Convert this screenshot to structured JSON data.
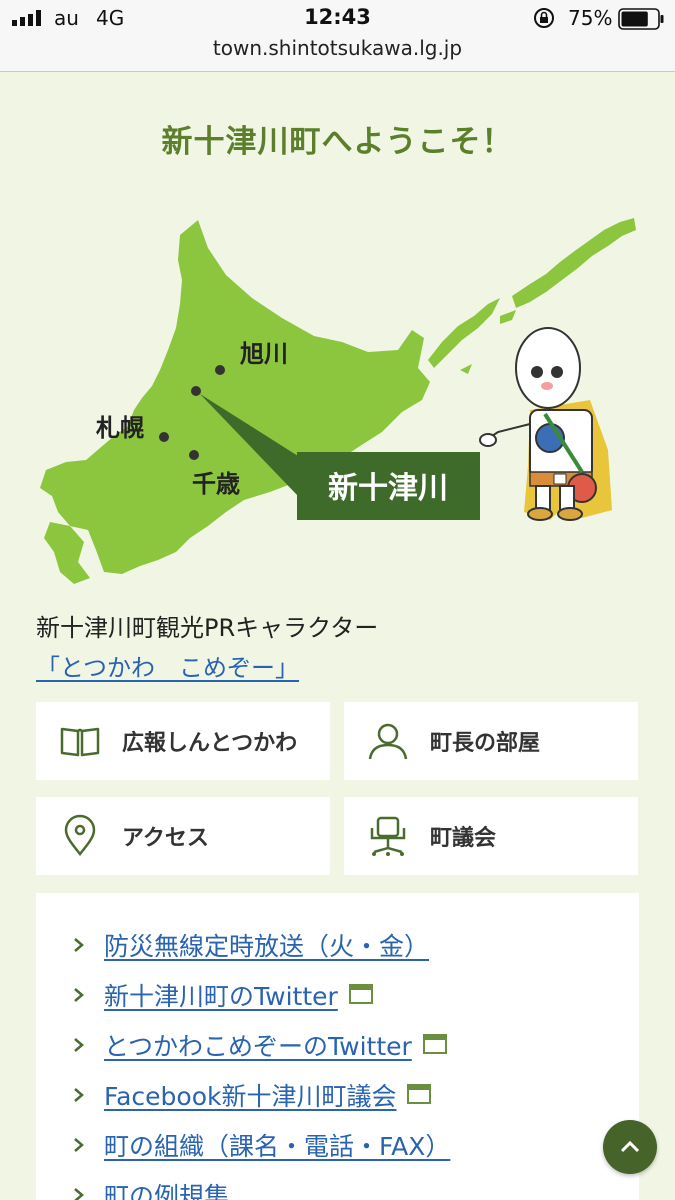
{
  "status_bar": {
    "carrier": "au",
    "network": "4G",
    "time": "12:43",
    "battery_percent": "75%",
    "battery_level": 0.75,
    "url": "town.shintotsukawa.lg.jp"
  },
  "hero": {
    "welcome": "新十津川町へようこそ！",
    "map": {
      "cities": {
        "asahikawa": "旭川",
        "sapporo": "札幌",
        "chitose": "千歳",
        "shintotsukawa": "新十津川"
      },
      "colors": {
        "land": "#8cc63f",
        "callout": "#3f6b2a"
      }
    },
    "pr_text": "新十津川町観光PRキャラクター",
    "pr_link": "「とつかわ　こめぞー」"
  },
  "tiles": [
    {
      "label": "広報しんとつかわ",
      "icon": "open-book-icon"
    },
    {
      "label": "町長の部屋",
      "icon": "person-icon"
    },
    {
      "label": "アクセス",
      "icon": "map-pin-icon"
    },
    {
      "label": "町議会",
      "icon": "office-chair-icon"
    }
  ],
  "links": [
    {
      "label": "防災無線定時放送（火・金）",
      "external": false
    },
    {
      "label": "新十津川町のTwitter",
      "external": true
    },
    {
      "label": "とつかわこめぞーのTwitter",
      "external": true
    },
    {
      "label": "Facebook新十津川町議会",
      "external": true
    },
    {
      "label": "町の組織（課名・電話・FAX）",
      "external": false
    },
    {
      "label": "町の例規集",
      "external": false
    }
  ],
  "colors": {
    "background": "#f1f6e4",
    "accent_green": "#5b7f2a",
    "link_blue": "#2a64b0",
    "scroll_button": "#46632a"
  }
}
